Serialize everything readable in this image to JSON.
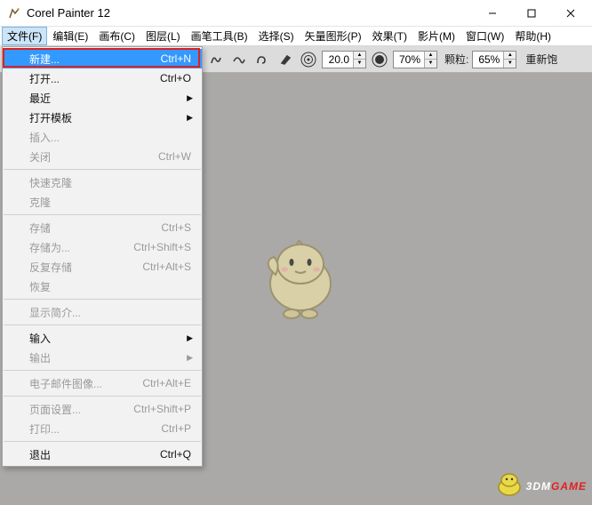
{
  "window": {
    "title": "Corel Painter 12"
  },
  "menubar": {
    "items": [
      {
        "label": "文件(F)",
        "open": true
      },
      {
        "label": "编辑(E)"
      },
      {
        "label": "画布(C)"
      },
      {
        "label": "图层(L)"
      },
      {
        "label": "画笔工具(B)"
      },
      {
        "label": "选择(S)"
      },
      {
        "label": "矢量图形(P)"
      },
      {
        "label": "效果(T)"
      },
      {
        "label": "影片(M)"
      },
      {
        "label": "窗口(W)"
      },
      {
        "label": "帮助(H)"
      }
    ]
  },
  "toolbar": {
    "size_value": "20.0",
    "opacity_value": "70%",
    "grain_label": "颗粒:",
    "grain_value": "65%",
    "resat_label": "重新饱"
  },
  "file_menu": {
    "items": [
      {
        "label": "新建...",
        "shortcut": "Ctrl+N",
        "hover": true
      },
      {
        "label": "打开...",
        "shortcut": "Ctrl+O"
      },
      {
        "label": "最近",
        "submenu": true
      },
      {
        "label": "打开模板",
        "submenu": true
      },
      {
        "label": "插入...",
        "disabled": true
      },
      {
        "label": "关闭",
        "shortcut": "Ctrl+W",
        "disabled": true
      },
      {
        "sep": true
      },
      {
        "label": "快速克隆",
        "disabled": true
      },
      {
        "label": "克隆",
        "disabled": true
      },
      {
        "sep": true
      },
      {
        "label": "存储",
        "shortcut": "Ctrl+S",
        "disabled": true
      },
      {
        "label": "存储为...",
        "shortcut": "Ctrl+Shift+S",
        "disabled": true
      },
      {
        "label": "反复存储",
        "shortcut": "Ctrl+Alt+S",
        "disabled": true
      },
      {
        "label": "恢复",
        "disabled": true
      },
      {
        "sep": true
      },
      {
        "label": "显示简介...",
        "disabled": true
      },
      {
        "sep": true
      },
      {
        "label": "输入",
        "submenu": true
      },
      {
        "label": "输出",
        "submenu": true,
        "disabled": true
      },
      {
        "sep": true
      },
      {
        "label": "电子邮件图像...",
        "shortcut": "Ctrl+Alt+E",
        "disabled": true
      },
      {
        "sep": true
      },
      {
        "label": "页面设置...",
        "shortcut": "Ctrl+Shift+P",
        "disabled": true
      },
      {
        "label": "打印...",
        "shortcut": "Ctrl+P",
        "disabled": true
      },
      {
        "sep": true
      },
      {
        "label": "退出",
        "shortcut": "Ctrl+Q"
      }
    ]
  },
  "watermark": {
    "text_plain": "3DM",
    "text_red": "GAME"
  }
}
